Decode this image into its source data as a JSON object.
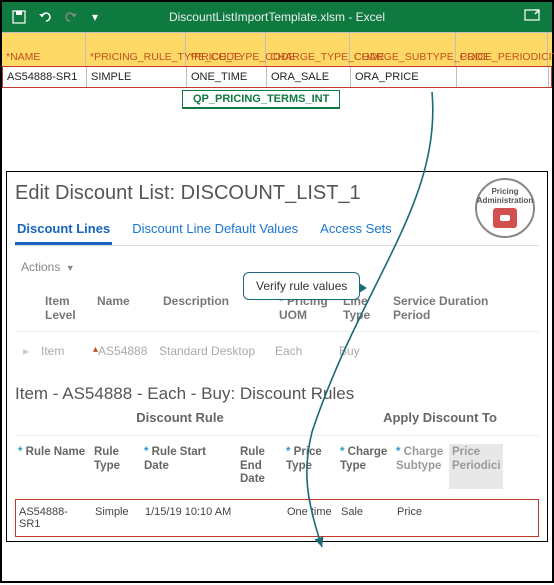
{
  "excel": {
    "title": "DiscountListImportTemplate.xlsm - Excel",
    "headers": [
      "*NAME",
      "*PRICING_RULE_TYPE_CODE",
      "*PRICE_TYPE_CODE",
      "CHARGE_TYPE_CODE",
      "CHARGE_SUBTYPE_CODE",
      "PRICE_PERIODICITY"
    ],
    "row": [
      "AS54888-SR1",
      "SIMPLE",
      "ONE_TIME",
      "ORA_SALE",
      "ORA_PRICE",
      ""
    ],
    "sheet_tab": "QP_PRICING_TERMS_INT"
  },
  "webapp": {
    "title": "Edit Discount List: DISCOUNT_LIST_1",
    "tabs": [
      "Discount Lines",
      "Discount Line Default Values",
      "Access Sets"
    ],
    "actions_label": "Actions",
    "badge_line1": "Pricing",
    "badge_line2": "Administration",
    "callout": "Verify rule values",
    "grid_headers": {
      "item_level": "Item Level",
      "name": "Name",
      "description": "Description",
      "pricing_uom": "Pricing UOM",
      "line_type": "Line Type",
      "service_duration_period": "Service Duration Period"
    },
    "grid_row": {
      "item_level": "Item",
      "name": "AS54888",
      "description": "Standard Desktop",
      "pricing_uom": "Each",
      "line_type": "Buy",
      "service_duration_period": ""
    },
    "section_title": "Item - AS54888 - Each - Buy: Discount Rules",
    "sub_headers": {
      "discount_rule": "Discount Rule",
      "apply_to": "Apply Discount To"
    },
    "rules_headers": {
      "rule_name": "Rule Name",
      "rule_type": "Rule Type",
      "rule_start_date": "Rule Start Date",
      "rule_end_date": "Rule End Date",
      "price_type": "Price Type",
      "charge_type": "Charge Type",
      "charge_subtype": "Charge Subtype",
      "price_periodicity": "Price Periodici"
    },
    "rules_row": {
      "rule_name": "AS54888-SR1",
      "rule_type": "Simple",
      "rule_start_date": "1/15/19 10:10 AM",
      "rule_end_date": "",
      "price_type": "One time",
      "charge_type": "Sale",
      "charge_subtype": "Price",
      "price_periodicity": ""
    }
  }
}
